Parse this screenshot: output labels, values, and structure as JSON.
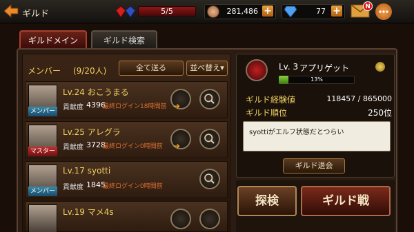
{
  "header": {
    "title": "ギルド",
    "stamina": "5/5",
    "coins": "281,486",
    "diamonds": "77",
    "mail_badge": "N"
  },
  "tabs": [
    {
      "label": "ギルドメイン",
      "active": true
    },
    {
      "label": "ギルド検索",
      "active": false
    }
  ],
  "members": {
    "label": "メンバー",
    "count": "(9/20人)",
    "send_all": "全て送る",
    "sort": "並べ替え▾",
    "list": [
      {
        "lvname": "Lv.24 おこうまる",
        "role": "メンバー",
        "contrib_label": "貢献度",
        "contrib": "4396",
        "login": "最終ログイン18時間前"
      },
      {
        "lvname": "Lv.25 アレグラ",
        "role": "マスター",
        "contrib_label": "貢献度",
        "contrib": "3728",
        "login": "最終ログイン0時間前"
      },
      {
        "lvname": "Lv.17 syotti",
        "role": "メンバー",
        "contrib_label": "貢献度",
        "contrib": "1845",
        "login": "最終ログイン0時間前"
      },
      {
        "lvname": "Lv.19 マメ4s",
        "role": "",
        "contrib_label": "",
        "contrib": "",
        "login": ""
      }
    ]
  },
  "guild": {
    "level": "Lv. 3",
    "name": "アプリゲット",
    "progress_text": "13%",
    "progress": 0.13,
    "exp_label": "ギルド経験値",
    "exp_value": "118457 / 865000",
    "rank_label": "ギルド順位",
    "rank_value": "250位",
    "message": "syottiがエルフ状態だとつらい",
    "leave": "ギルド退会"
  },
  "actions": {
    "explore": "探検",
    "guild_war": "ギルド戦"
  },
  "colors": {
    "accent_gold": "#f0d060",
    "stamina_red": "#8a1818",
    "progress_green": "#8ad040"
  }
}
